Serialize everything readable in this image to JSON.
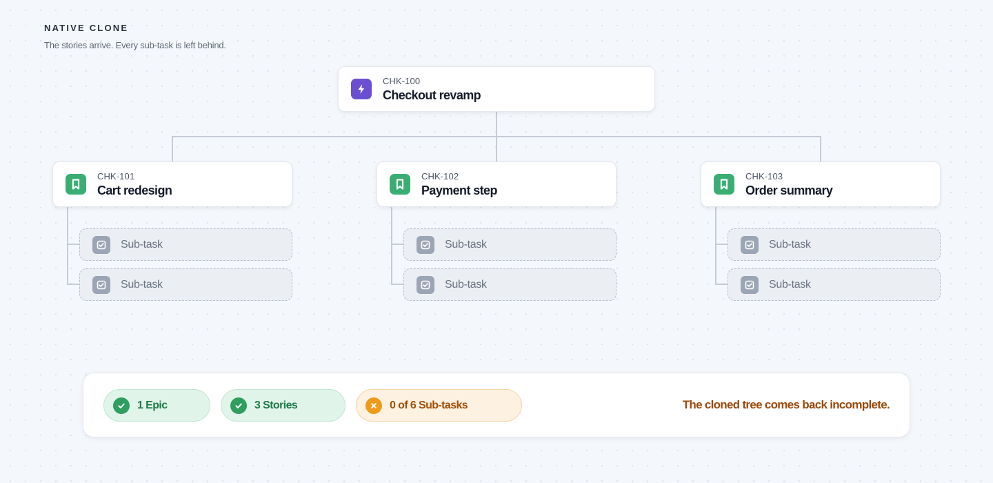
{
  "header": {
    "eyebrow": "NATIVE CLONE",
    "subtitle": "The stories arrive. Every sub-task is left behind."
  },
  "epic": {
    "key": "CHK-100",
    "title": "Checkout revamp",
    "icon": "lightning-bolt-icon",
    "color": "#6b4fd1"
  },
  "stories": [
    {
      "key": "CHK-101",
      "title": "Cart redesign",
      "icon": "bookmark-icon",
      "color": "#3aae72",
      "subtasks": [
        {
          "label": "Sub-task"
        },
        {
          "label": "Sub-task"
        }
      ]
    },
    {
      "key": "CHK-102",
      "title": "Payment step",
      "icon": "bookmark-icon",
      "color": "#3aae72",
      "subtasks": [
        {
          "label": "Sub-task"
        },
        {
          "label": "Sub-task"
        }
      ]
    },
    {
      "key": "CHK-103",
      "title": "Order summary",
      "icon": "bookmark-icon",
      "color": "#3aae72",
      "subtasks": [
        {
          "label": "Sub-task"
        },
        {
          "label": "Sub-task"
        }
      ]
    }
  ],
  "subtask_icon": "checkbox-icon",
  "summary": {
    "pills": [
      {
        "label": "1 Epic",
        "status": "ok",
        "icon": "check-circle-icon"
      },
      {
        "label": "3 Stories",
        "status": "ok",
        "icon": "check-circle-icon"
      },
      {
        "label": "0 of 6 Sub-tasks",
        "status": "missing",
        "icon": "x-circle-icon"
      }
    ],
    "verdict": "The cloned tree comes back incomplete."
  },
  "colors": {
    "success": "#2f9e5f",
    "warning": "#ef9a1a",
    "connector": "#c6ccd6"
  }
}
